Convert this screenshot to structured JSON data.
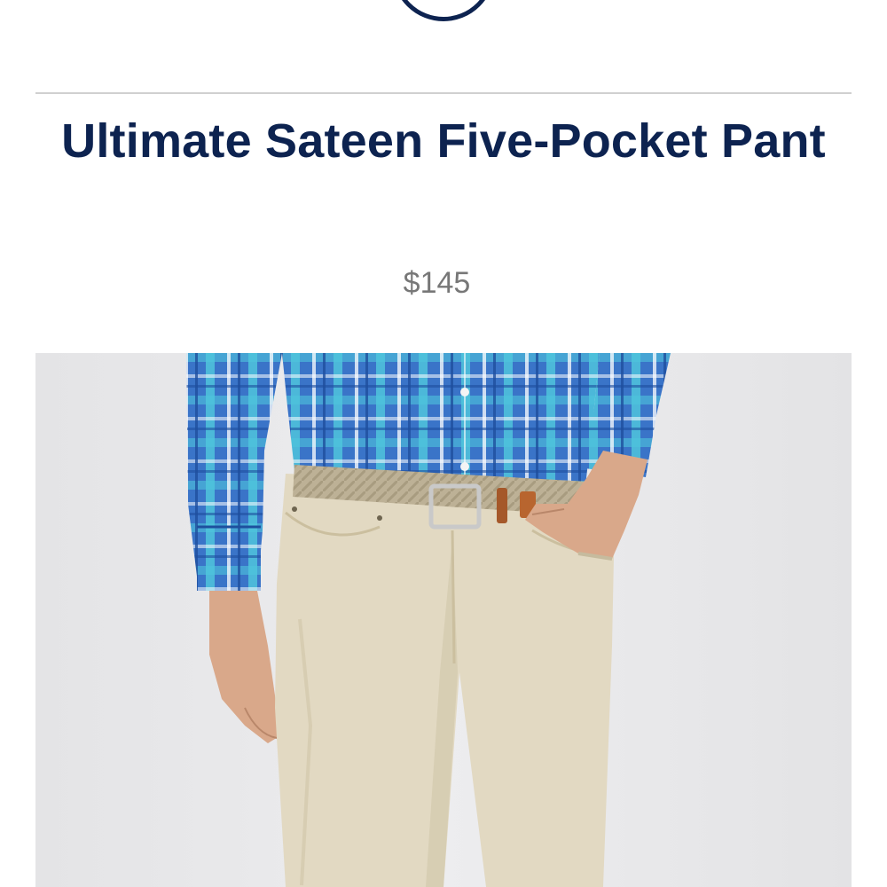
{
  "header": {
    "logo": "brand-logo-circle"
  },
  "product": {
    "title": "Ultimate Sateen Five-Pocket Pant",
    "price": "$145",
    "image": "model-wearing-khaki-pants-and-blue-plaid-shirt"
  },
  "colors": {
    "navy": "#0d2350",
    "price_gray": "#777777",
    "divider": "#d0d0d0",
    "backdrop": "#eaeaec",
    "shirt_blue": "#3a74c8",
    "shirt_aqua": "#4fc4dc",
    "pant_khaki": "#e2d9c2",
    "belt": "#b9ad92",
    "skin": "#d9a88a"
  }
}
